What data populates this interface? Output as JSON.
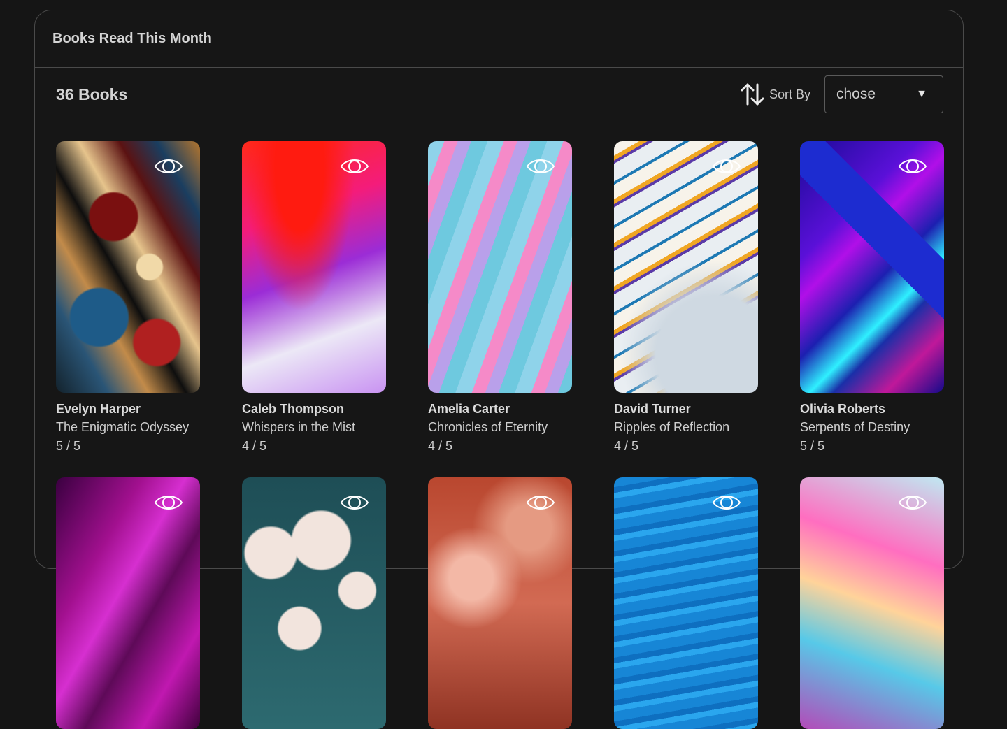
{
  "header": {
    "title": "Books Read This Month"
  },
  "toolbar": {
    "count_label": "36 Books",
    "sort_label": "Sort By",
    "sort_icon": "sort-arrows-icon",
    "select_value": "chose"
  },
  "books": [
    {
      "author": "Evelyn Harper",
      "title": "The Enigmatic Odyssey",
      "rating": "5 / 5"
    },
    {
      "author": "Caleb Thompson",
      "title": "Whispers in the Mist",
      "rating": "4 / 5"
    },
    {
      "author": "Amelia Carter",
      "title": "Chronicles of Eternity",
      "rating": "4 / 5"
    },
    {
      "author": "David Turner",
      "title": "Ripples of Reflection",
      "rating": "4 / 5"
    },
    {
      "author": "Olivia Roberts",
      "title": "Serpents of Destiny",
      "rating": "5 / 5"
    },
    {
      "author": "",
      "title": "",
      "rating": ""
    },
    {
      "author": "",
      "title": "",
      "rating": ""
    },
    {
      "author": "",
      "title": "",
      "rating": ""
    },
    {
      "author": "",
      "title": "",
      "rating": ""
    },
    {
      "author": "",
      "title": "",
      "rating": ""
    }
  ]
}
